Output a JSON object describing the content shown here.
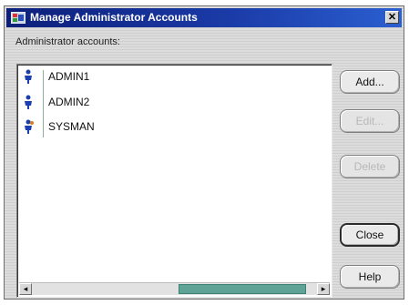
{
  "window": {
    "title": "Manage Administrator Accounts",
    "close_glyph": "✕",
    "app_icon": "admin-accounts-icon"
  },
  "section_label": "Administrator accounts:",
  "accounts": [
    {
      "name": "ADMIN1",
      "icon": "person-icon"
    },
    {
      "name": "ADMIN2",
      "icon": "person-icon"
    },
    {
      "name": "SYSMAN",
      "icon": "person-highlight-icon"
    }
  ],
  "buttons": {
    "add": "Add...",
    "edit": "Edit...",
    "delete": "Delete",
    "close": "Close",
    "help": "Help"
  },
  "scrollbar": {
    "left_arrow": "◂",
    "right_arrow": "▸"
  },
  "colors": {
    "titlebar": "#1a3aa6",
    "scroll_thumb": "#5fa396",
    "person_blue": "#1b3fb0",
    "person_orange": "#e07a1c"
  }
}
